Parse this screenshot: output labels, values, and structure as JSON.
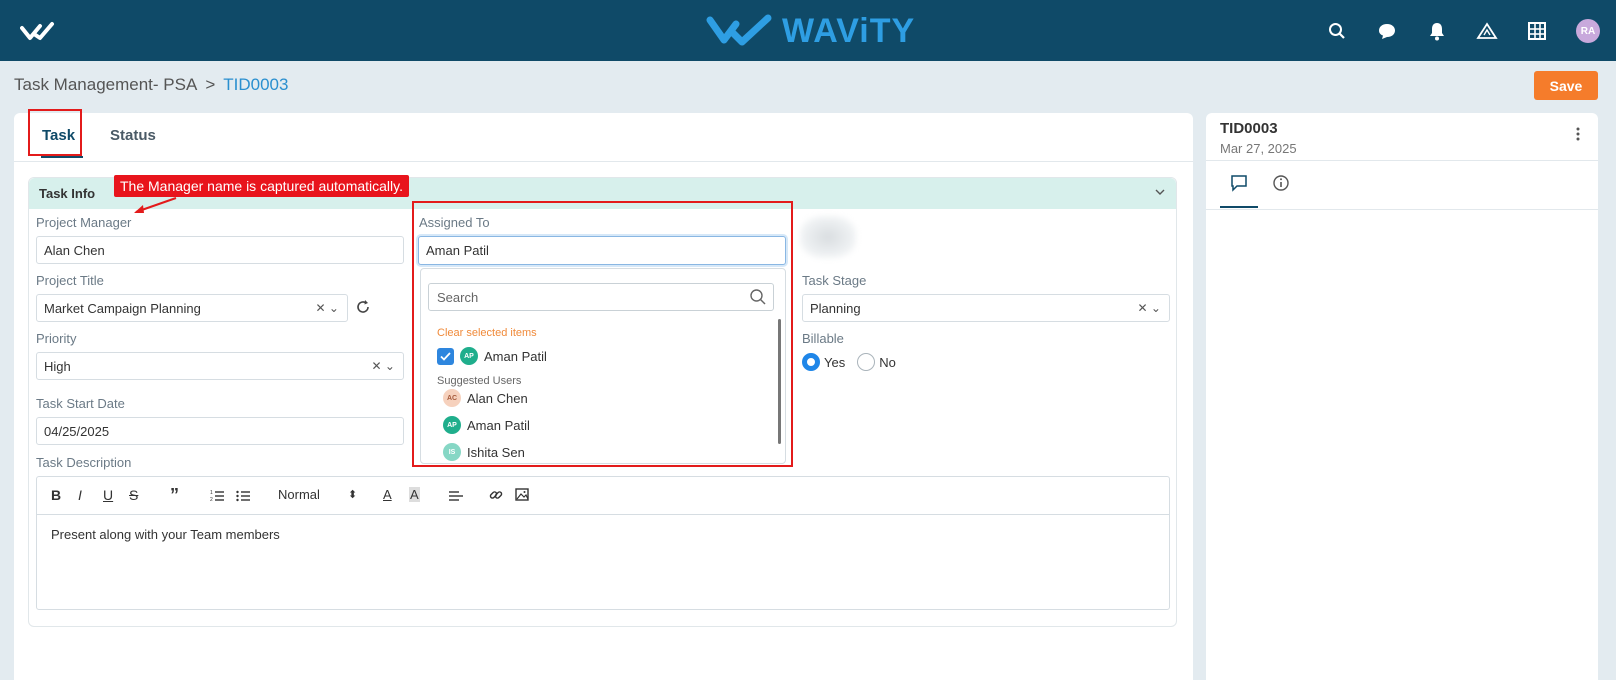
{
  "app": {
    "brand": "WAViTY",
    "user_initials": "RA"
  },
  "header_icons": [
    "search-icon",
    "chat-icon",
    "bell-icon",
    "triangle-app-icon",
    "grid-icon"
  ],
  "breadcrumb": {
    "parent": "Task Management- PSA",
    "separator": ">",
    "current": "TID0003"
  },
  "actions": {
    "save_label": "Save"
  },
  "tabs": {
    "task": "Task",
    "status": "Status"
  },
  "section": {
    "title": "Task Info"
  },
  "annotation": {
    "callout": "The Manager name is captured automatically."
  },
  "fields": {
    "project_manager": {
      "label": "Project Manager",
      "value": "Alan Chen"
    },
    "project_title": {
      "label": "Project Title",
      "value": "Market Campaign Planning"
    },
    "priority": {
      "label": "Priority",
      "value": "High"
    },
    "task_start_date": {
      "label": "Task Start Date",
      "value": "04/25/2025"
    },
    "task_description": {
      "label": "Task Description",
      "value": "Present along with your Team members",
      "format": "Normal"
    },
    "assigned_to": {
      "label": "Assigned To",
      "value": "Aman Patil"
    },
    "task_stage": {
      "label": "Task Stage",
      "value": "Planning"
    },
    "billable": {
      "label": "Billable",
      "yes": "Yes",
      "no": "No",
      "selected": "Yes"
    }
  },
  "assignee_dropdown": {
    "search_placeholder": "Search",
    "clear_label": "Clear selected items",
    "selected": [
      {
        "initials": "AP",
        "name": "Aman Patil"
      }
    ],
    "suggested_label": "Suggested Users",
    "suggested": [
      {
        "initials": "AC",
        "name": "Alan Chen"
      },
      {
        "initials": "AP",
        "name": "Aman Patil"
      },
      {
        "initials": "IS",
        "name": "Ishita Sen"
      }
    ]
  },
  "side_panel": {
    "id": "TID0003",
    "date": "Mar 27, 2025"
  },
  "colors": {
    "header": "#0f4a68",
    "accent": "#2e9ee3",
    "save": "#f57c2b",
    "annotation": "#e31b1b"
  }
}
